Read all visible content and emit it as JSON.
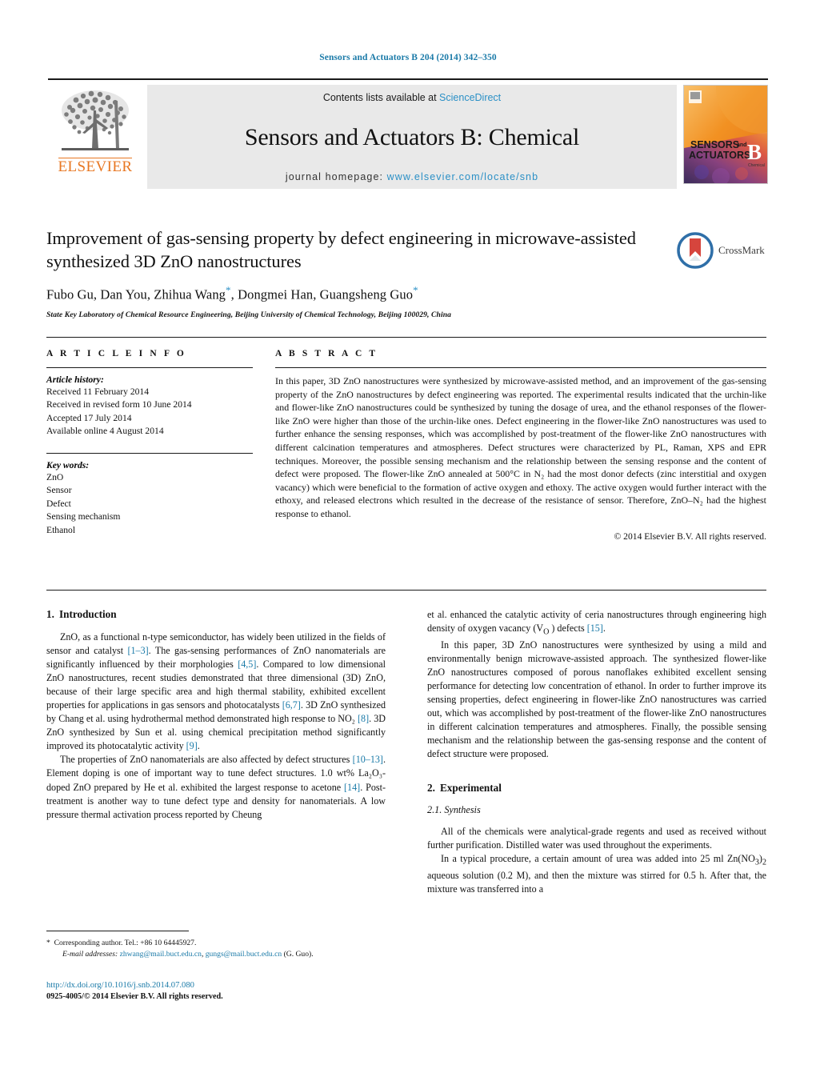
{
  "running_head": "Sensors and Actuators B 204 (2014) 342–350",
  "masthead": {
    "publisher_name": "ELSEVIER",
    "contents_prefix": "Contents lists available at ",
    "contents_link": "ScienceDirect",
    "journal_title": "Sensors and Actuators B: Chemical",
    "homepage_prefix": "journal homepage: ",
    "homepage_url": "www.elsevier.com/locate/snb",
    "cover_line1": "SENSORS",
    "cover_and": "and",
    "cover_line2": "ACTUATORS",
    "cover_letter": "B",
    "cover_sub": "Chemical"
  },
  "article": {
    "title": "Improvement of gas-sensing property by defect engineering in microwave-assisted synthesized 3D ZnO nanostructures",
    "authors": "Fubo Gu, Dan You, Zhihua Wang",
    "authors_mid": ", Dongmei Han, Guangsheng Guo",
    "affiliation": "State Key Laboratory of Chemical Resource Engineering, Beijing University of Chemical Technology, Beijing 100029, China",
    "crossmark_label": "CrossMark"
  },
  "article_info": {
    "heading": "A R T I C L E    I N F O",
    "history_label": "Article history:",
    "history": [
      "Received 11 February 2014",
      "Received in revised form 10 June 2014",
      "Accepted 17 July 2014",
      "Available online 4 August 2014"
    ],
    "keywords_label": "Key words:",
    "keywords": [
      "ZnO",
      "Sensor",
      "Defect",
      "Sensing mechanism",
      "Ethanol"
    ]
  },
  "abstract": {
    "heading": "A B S T R A C T",
    "text": "In this paper, 3D ZnO nanostructures were synthesized by microwave-assisted method, and an improvement of the gas-sensing property of the ZnO nanostructures by defect engineering was reported. The experimental results indicated that the urchin-like and flower-like ZnO nanostructures could be synthesized by tuning the dosage of urea, and the ethanol responses of the flower-like ZnO were higher than those of the urchin-like ones. Defect engineering in the flower-like ZnO nanostructures was used to further enhance the sensing responses, which was accomplished by post-treatment of the flower-like ZnO nanostructures with different calcination temperatures and atmospheres. Defect structures were characterized by PL, Raman, XPS and EPR techniques. Moreover, the possible sensing mechanism and the relationship between the sensing response and the content of defect were proposed. The flower-like ZnO annealed at 500°C in N₂ had the most donor defects (zinc interstitial and oxygen vacancy) which were beneficial to the formation of active oxygen and ethoxy. The active oxygen would further interact with the ethoxy, and released electrons which resulted in the decrease of the resistance of sensor. Therefore, ZnO–N₂ had the highest response to ethanol.",
    "copyright": "© 2014 Elsevier B.V. All rights reserved."
  },
  "sections": {
    "intro_heading_num": "1.",
    "intro_heading": "Introduction",
    "intro_p1_a": "ZnO, as a functional n-type semiconductor, has widely been utilized in the fields of sensor and catalyst ",
    "intro_p1_c1": "[1–3]",
    "intro_p1_b": ". The gas-sensing performances of ZnO nanomaterials are significantly influenced by their morphologies ",
    "intro_p1_c2": "[4,5]",
    "intro_p1_c": ". Compared to low dimensional ZnO nanostructures, recent studies demonstrated that three dimensional (3D) ZnO, because of their large specific area and high thermal stability, exhibited excellent properties for applications in gas sensors and photocatalysts ",
    "intro_p1_c3": "[6,7]",
    "intro_p1_d": ". 3D ZnO synthesized by Chang et al. using hydrothermal method demonstrated high response to NO₂ ",
    "intro_p1_c4": "[8]",
    "intro_p1_e": ". 3D ZnO synthesized by Sun et al. using chemical precipitation method significantly improved its photocatalytic activity ",
    "intro_p1_c5": "[9]",
    "intro_p1_f": ".",
    "intro_p2_a": "The properties of ZnO nanomaterials are also affected by defect structures ",
    "intro_p2_c1": "[10–13]",
    "intro_p2_b": ". Element doping is one of important way to tune defect structures. 1.0 wt% La₂O₃-doped ZnO prepared by He et al. exhibited the largest response to acetone ",
    "intro_p2_c2": "[14]",
    "intro_p2_c": ". Post-treatment is another way to tune defect type and density for nanomaterials. A low pressure thermal activation process reported by Cheung",
    "intro_p3_a": "et al. enhanced the catalytic activity of ceria nanostructures through engineering high density of oxygen vacancy (V",
    "intro_p3_sub": "O",
    "intro_p3_b": " ) defects ",
    "intro_p3_c1": "[15]",
    "intro_p3_c": ".",
    "intro_p4": "In this paper, 3D ZnO nanostructures were synthesized by using a mild and environmentally benign microwave-assisted approach. The synthesized flower-like ZnO nanostructures composed of porous nanoflakes exhibited excellent sensing performance for detecting low concentration of ethanol. In order to further improve its sensing properties, defect engineering in flower-like ZnO nanostructures was carried out, which was accomplished by post-treatment of the flower-like ZnO nanostructures in different calcination temperatures and atmospheres. Finally, the possible sensing mechanism and the relationship between the gas-sensing response and the content of defect structure were proposed.",
    "exp_heading_num": "2.",
    "exp_heading": "Experimental",
    "synth_heading": "2.1.  Synthesis",
    "synth_p1": "All of the chemicals were analytical-grade regents and used as received without further purification. Distilled water was used throughout the experiments.",
    "synth_p2_a": "In a typical procedure, a certain amount of urea was added into 25 ml Zn(NO",
    "synth_p2_sub1": "3",
    "synth_p2_b": ")",
    "synth_p2_sub2": "2",
    "synth_p2_c": " aqueous solution (0.2 M), and then the mixture was stirred for 0.5 h. After that, the mixture was transferred into a"
  },
  "footer": {
    "corr_marker": "*",
    "corr_text": "Corresponding author. Tel.: +86 10 64445927.",
    "email_label": "E-mail addresses:",
    "email1": "zhwang@mail.buct.edu.cn",
    "email_sep": ", ",
    "email2": "gungs@mail.buct.edu.cn",
    "email_suffix": " (G. Guo).",
    "doi": "http://dx.doi.org/10.1016/j.snb.2014.07.080",
    "issn": "0925-4005/© 2014 Elsevier B.V. All rights reserved."
  },
  "colors": {
    "link_blue": "#1a7aa8",
    "sciencedirect_blue": "#2b90c6",
    "elsevier_orange": "#e87722",
    "masthead_bg": "#e9e9e9"
  }
}
